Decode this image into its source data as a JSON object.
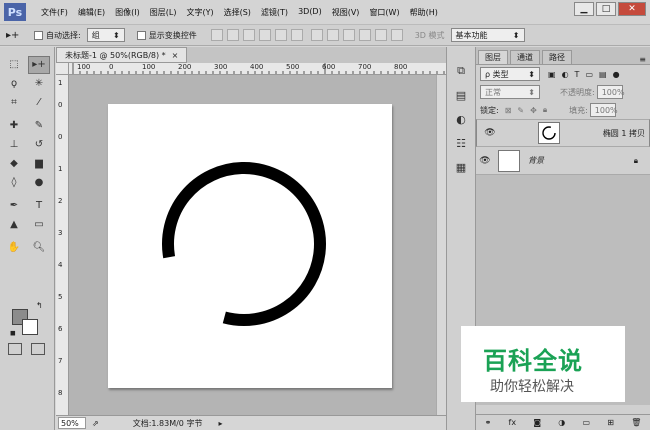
{
  "app": {
    "logo": "Ps"
  },
  "menu": [
    "文件(F)",
    "编辑(E)",
    "图像(I)",
    "图层(L)",
    "文字(Y)",
    "选择(S)",
    "滤镜(T)",
    "3D(D)",
    "视图(V)",
    "窗口(W)",
    "帮助(H)"
  ],
  "window_controls": {
    "minimize": "▁",
    "restore": "□",
    "close": "✕"
  },
  "options_bar": {
    "auto_select_label": "自动选择:",
    "auto_select_value": "组",
    "show_transform_label": "显示变换控件",
    "mode_3d_label": "3D 模式",
    "workspace_value": "基本功能"
  },
  "document": {
    "tab_title": "未标题-1 @ 50%(RGB/8) *",
    "tab_close": "×",
    "ruler_top_labels": [
      "100",
      "0",
      "100",
      "200",
      "300",
      "400",
      "500",
      "600",
      "700",
      "800"
    ],
    "ruler_left_labels": [
      "1",
      "0",
      "0",
      "1",
      "2",
      "3",
      "4",
      "5",
      "6",
      "7",
      "8",
      "9",
      "1"
    ],
    "zoom": "50%",
    "status": "文档:1.83M/0 字节"
  },
  "layers_panel": {
    "tabs": [
      "图层",
      "通道",
      "路径"
    ],
    "filter_label": "ρ 类型",
    "blend_mode": "正常",
    "opacity_label": "不透明度:",
    "opacity_value": "100%",
    "lock_label": "锁定:",
    "fill_label": "填充:",
    "fill_value": "100%",
    "layers": [
      {
        "name": "椭圆 1 拷贝",
        "visible": true,
        "selected": true
      },
      {
        "name": "背景",
        "visible": true,
        "locked": true
      }
    ],
    "footer_icons": [
      "link-icon",
      "fx-icon",
      "mask-icon",
      "adjustment-icon",
      "folder-icon",
      "new-layer-icon",
      "trash-icon"
    ]
  },
  "watermark": {
    "title": "百科全说",
    "subtitle": "助你轻松解决"
  },
  "colors": {
    "ring": "#000000",
    "canvas_bg": "#ffffff",
    "workspace": "#b4b4b4",
    "brand": "#1aa255"
  }
}
